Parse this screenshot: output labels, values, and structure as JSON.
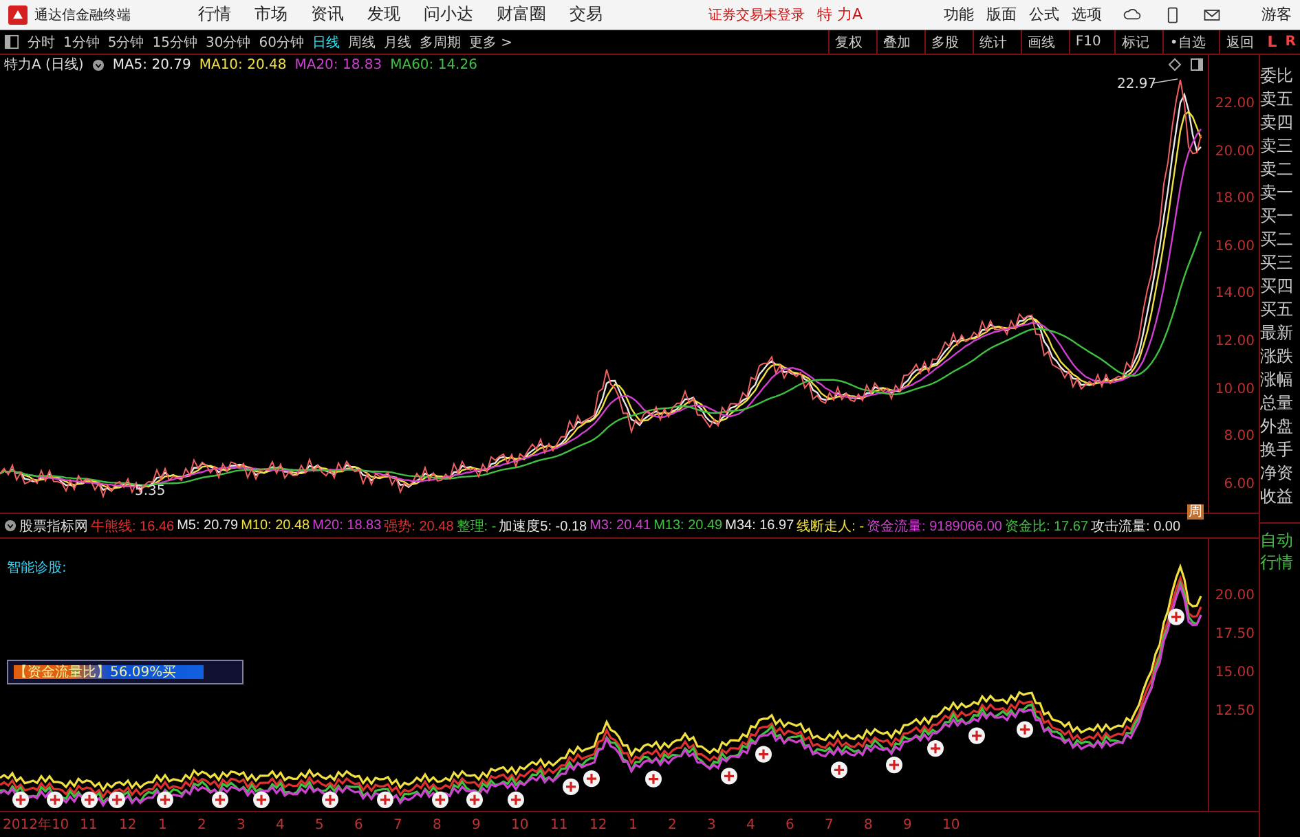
{
  "window": {
    "title": "通达信金融终端"
  },
  "menu": [
    "行情",
    "市场",
    "资讯",
    "发现",
    "问小达",
    "财富圈",
    "交易"
  ],
  "login_status": "证券交易未登录",
  "stock_name": "特 力A",
  "right_menu": [
    "功能",
    "版面",
    "公式",
    "选项"
  ],
  "user": "游客",
  "periods": [
    {
      "label": "分时",
      "selected": false
    },
    {
      "label": "1分钟",
      "selected": false
    },
    {
      "label": "5分钟",
      "selected": false
    },
    {
      "label": "15分钟",
      "selected": false
    },
    {
      "label": "30分钟",
      "selected": false
    },
    {
      "label": "60分钟",
      "selected": false
    },
    {
      "label": "日线",
      "selected": true
    },
    {
      "label": "周线",
      "selected": false
    },
    {
      "label": "月线",
      "selected": false
    },
    {
      "label": "多周期",
      "selected": false
    },
    {
      "label": "更多 >",
      "selected": false
    }
  ],
  "tools": [
    "复权",
    "叠加",
    "多股",
    "统计",
    "画线",
    "F10",
    "标记",
    "•自选",
    "返回"
  ],
  "corner": {
    "left": "L",
    "right": "R"
  },
  "price_chart": {
    "title": "特力A (日线)",
    "ma": [
      {
        "label": "MA5: 20.79",
        "color": "#e8e8e8"
      },
      {
        "label": "MA10: 20.48",
        "color": "#f0e040"
      },
      {
        "label": "MA20: 18.83",
        "color": "#d040d0"
      },
      {
        "label": "MA60: 14.26",
        "color": "#40c040"
      }
    ],
    "high_label": "22.97",
    "low_label": "5.35",
    "period_marker": "周",
    "axis": [
      "22.00",
      "20.00",
      "18.00",
      "16.00",
      "14.00",
      "12.00",
      "10.00",
      "8.00",
      "6.00"
    ]
  },
  "quote_panel": {
    "items": [
      "委比",
      "卖五",
      "卖四",
      "卖三",
      "卖二",
      "卖一",
      "买一",
      "买二",
      "买三",
      "买四",
      "买五",
      "最新",
      "涨跌",
      "涨幅",
      "总量",
      "外盘",
      "换手",
      "净资",
      "收益"
    ],
    "auto": "自动行情"
  },
  "indicator": {
    "name": "股票指标网",
    "values": [
      {
        "label": "牛熊线: 16.46",
        "color": "#e03030"
      },
      {
        "label": "M5: 20.79",
        "color": "#e8e8e8"
      },
      {
        "label": "M10: 20.48",
        "color": "#f0e040"
      },
      {
        "label": "M20: 18.83",
        "color": "#d040d0"
      },
      {
        "label": "强势: 20.48",
        "color": "#e03030"
      },
      {
        "label": "整理: -",
        "color": "#40c040"
      },
      {
        "label": "加速度5: -0.18",
        "color": "#e8e8e8"
      },
      {
        "label": "M3: 20.41",
        "color": "#d040d0"
      },
      {
        "label": "M13: 20.49",
        "color": "#40c040"
      },
      {
        "label": "M34: 16.97",
        "color": "#e8e8e8"
      },
      {
        "label": "线断走人: -",
        "color": "#f0e040"
      },
      {
        "label": "资金流量: 9189066.00",
        "color": "#d040d0"
      },
      {
        "label": "资金比: 17.67",
        "color": "#40c040"
      },
      {
        "label": "攻击流量: 0.00",
        "color": "#e8e8e8"
      }
    ],
    "diagnosis": "智能诊股:",
    "meter": {
      "label": "【资金流量比】56.09%买",
      "level": 0.85
    },
    "axis": [
      "20.00",
      "17.50",
      "15.00",
      "12.50"
    ]
  },
  "dates": [
    "2012年10",
    "11",
    "12",
    "1",
    "2",
    "3",
    "4",
    "5",
    "6",
    "7",
    "8",
    "9",
    "10",
    "11",
    "12",
    "1",
    "2",
    "3",
    "4",
    "6",
    "7",
    "8",
    "9",
    "10"
  ]
}
